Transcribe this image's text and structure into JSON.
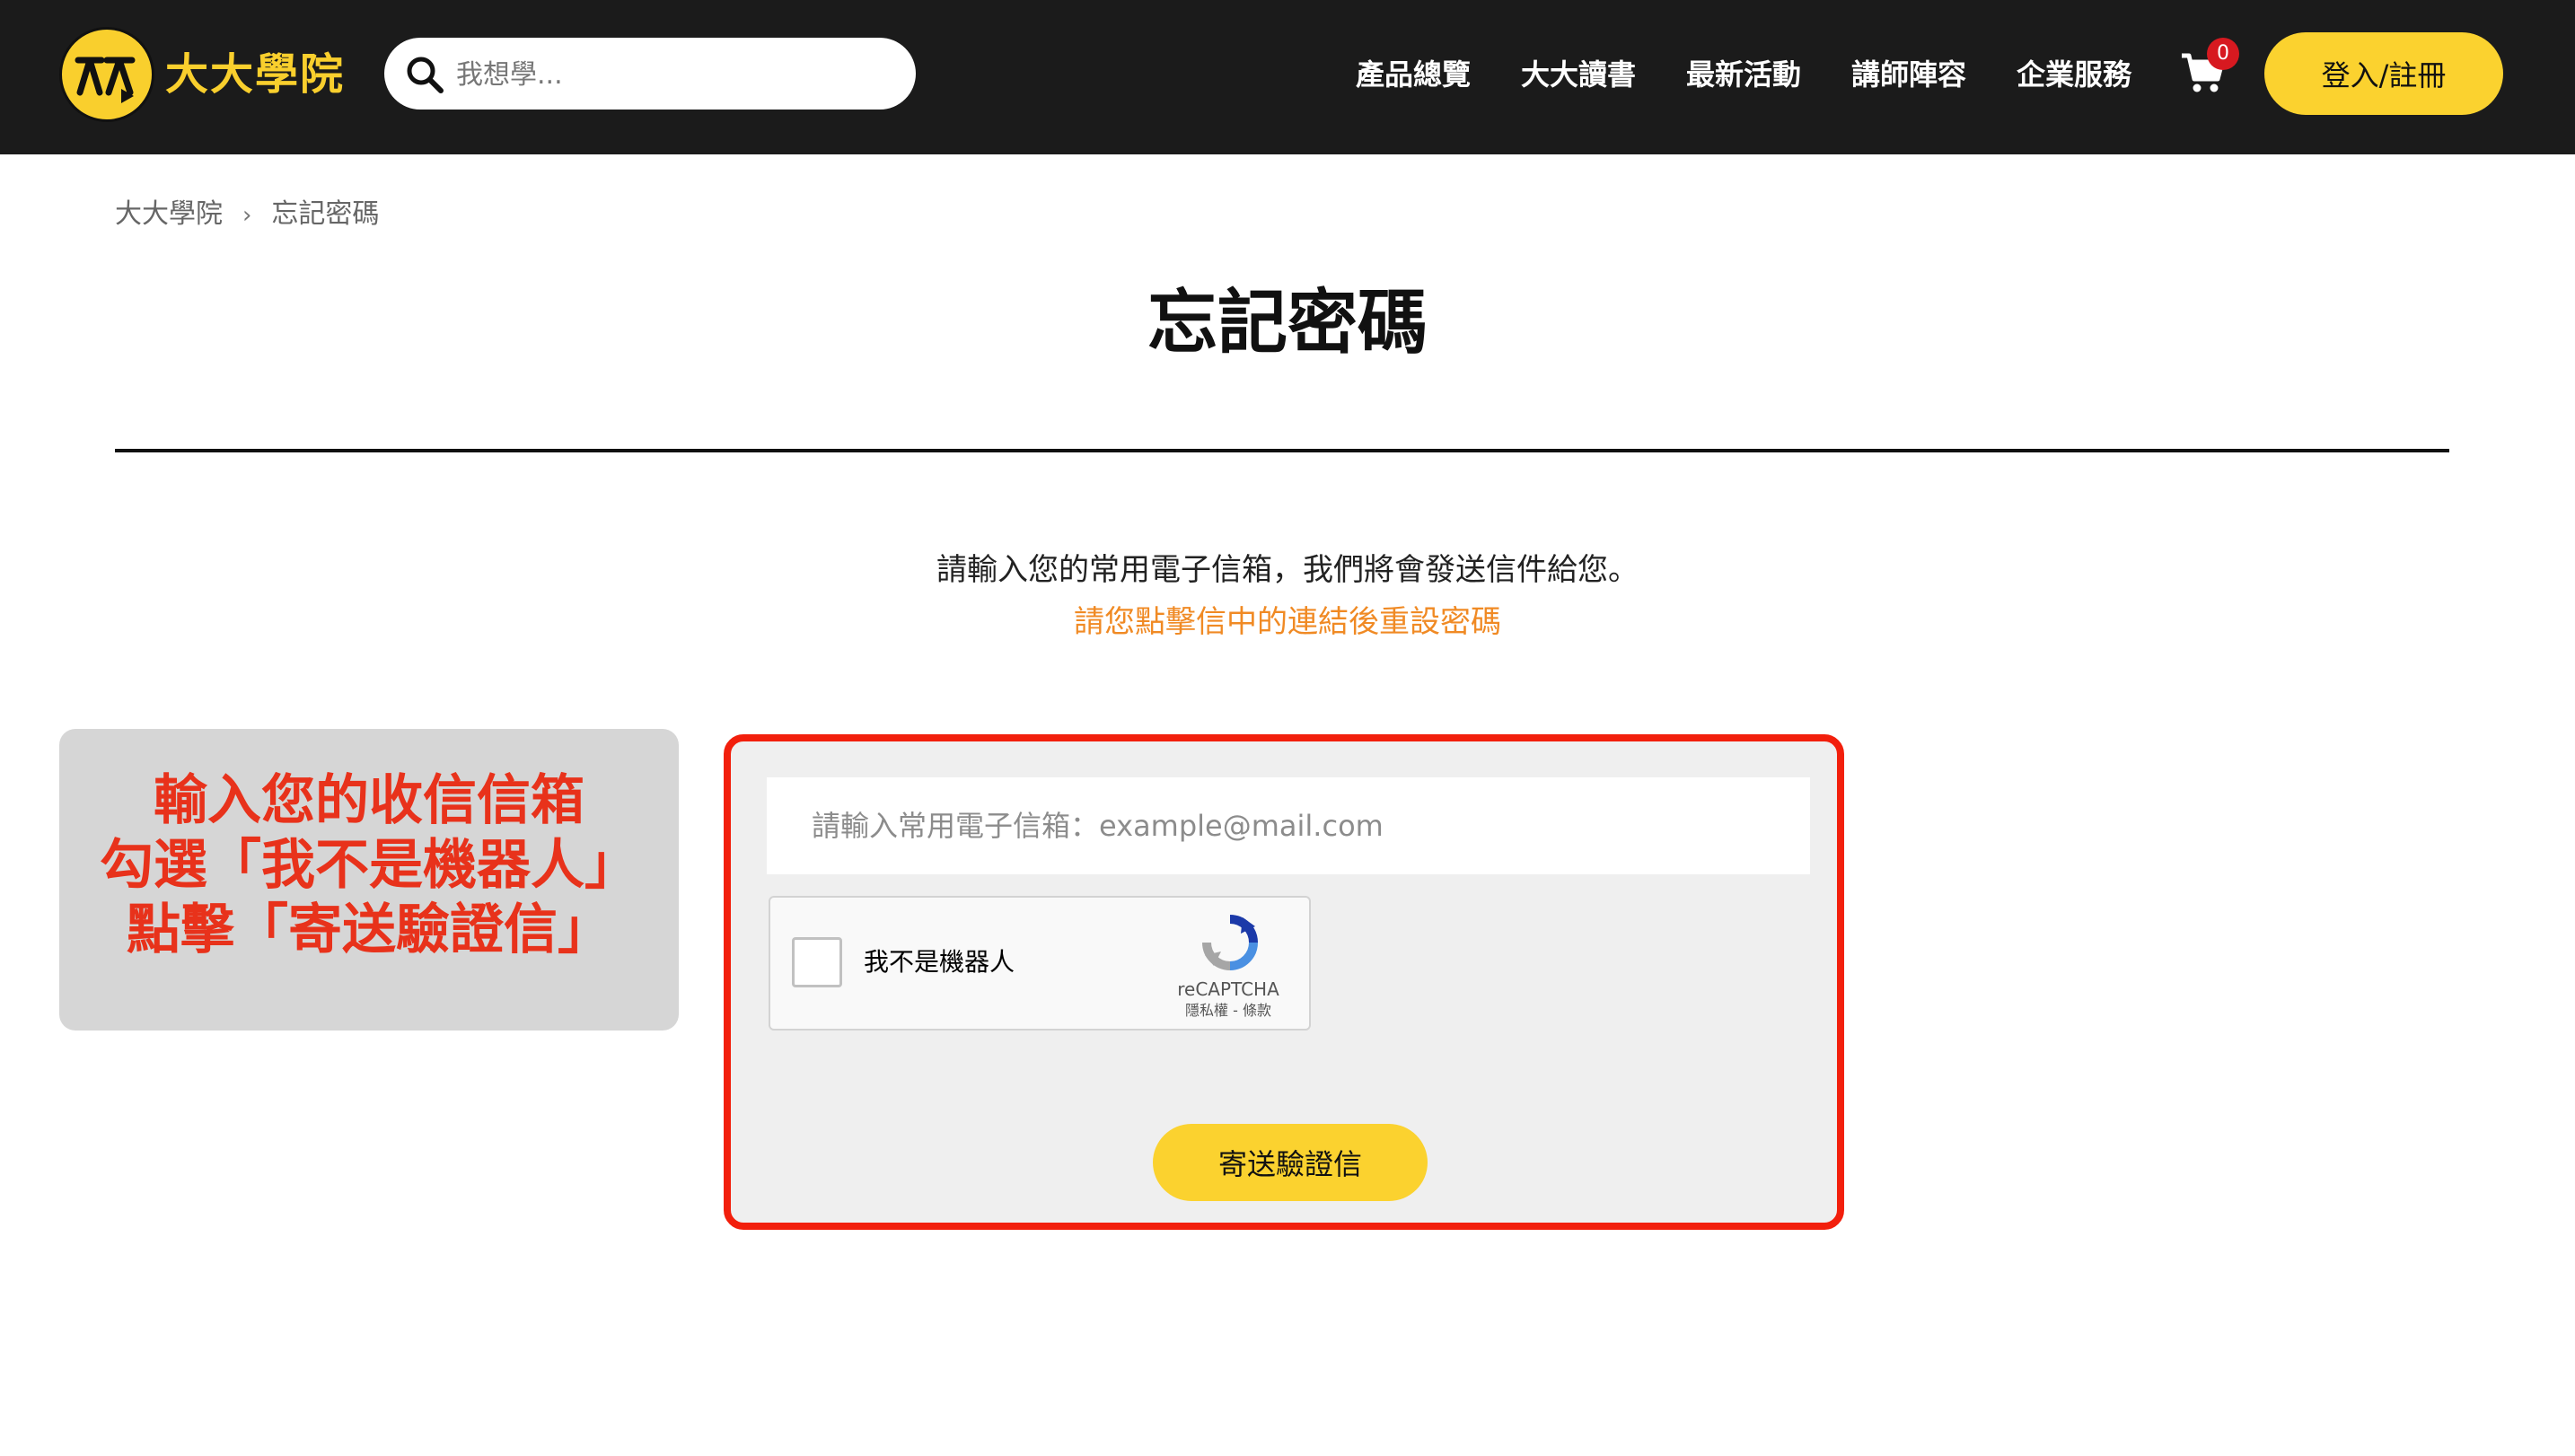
{
  "header": {
    "logo_text": "大大學院",
    "search": {
      "placeholder": "我想學..."
    },
    "nav": [
      "產品總覽",
      "大大讀書",
      "最新活動",
      "講師陣容",
      "企業服務"
    ],
    "cart_count": "0",
    "login_label": "登入/註冊"
  },
  "breadcrumb": {
    "home": "大大學院",
    "current": "忘記密碼"
  },
  "page": {
    "title": "忘記密碼",
    "intro": "請輸入您的常用電子信箱，我們將會發送信件給您。",
    "intro_note": "請您點擊信中的連結後重設密碼"
  },
  "annotation": {
    "lines": [
      "輸入您的收信信箱",
      "勾選「我不是機器人」",
      "點擊「寄送驗證信」"
    ]
  },
  "form": {
    "email_placeholder": "請輸入常用電子信箱：example@mail.com",
    "email_value": "",
    "recaptcha": {
      "label": "我不是機器人",
      "brand": "reCAPTCHA",
      "terms": "隱私權 - 條款"
    },
    "submit_label": "寄送驗證信"
  },
  "colors": {
    "topbar": "#1b1b1b",
    "brand_yellow": "#fbd22f",
    "highlight_red": "#f21f0c",
    "note_orange": "#f08a24",
    "badge_red": "#d71920"
  }
}
